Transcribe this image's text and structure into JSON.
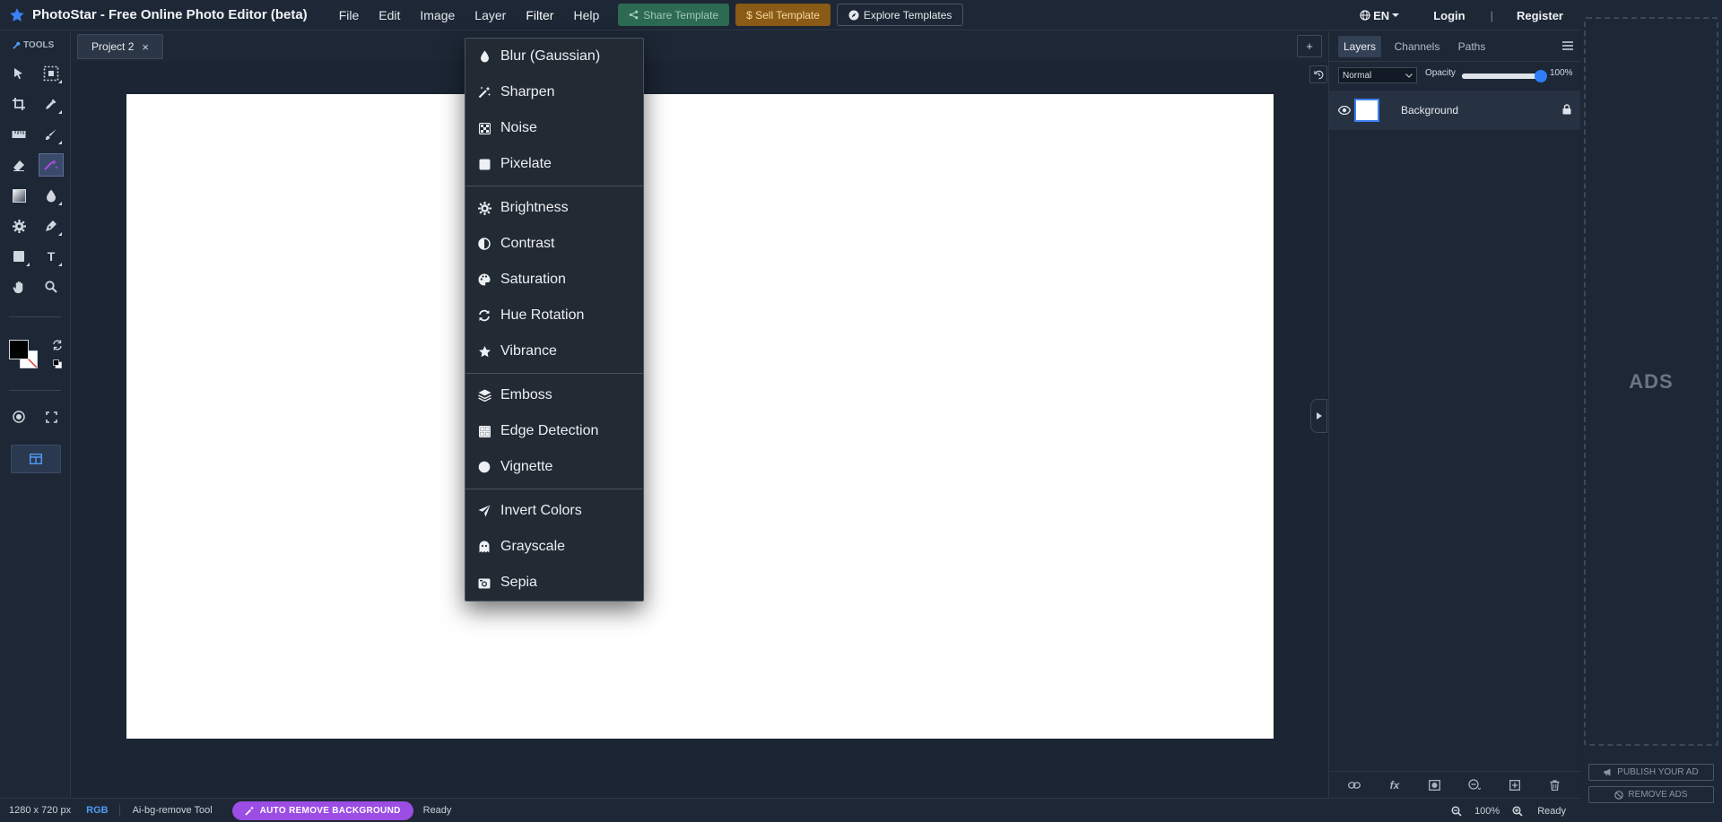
{
  "app": {
    "title": "PhotoStar - Free Online Photo Editor (beta)",
    "menus": [
      "File",
      "Edit",
      "Image",
      "Layer",
      "Filter",
      "Help"
    ],
    "share_template": "Share Template",
    "sell_template": "$ Sell Template",
    "explore_templates": "Explore Templates",
    "language": "EN",
    "login": "Login",
    "separator": "|",
    "register": "Register"
  },
  "toolbar": {
    "label": "TOOLS",
    "tools": [
      {
        "name": "move-tool-icon"
      },
      {
        "name": "marquee-select-tool-icon"
      },
      {
        "name": "crop-tool-icon"
      },
      {
        "name": "eyedropper-tool-icon"
      },
      {
        "name": "ruler-tool-icon"
      },
      {
        "name": "brush-tool-icon"
      },
      {
        "name": "eraser-tool-icon"
      },
      {
        "name": "magic-wand-tool-icon"
      },
      {
        "name": "gradient-tool-icon"
      },
      {
        "name": "blur-drop-tool-icon"
      },
      {
        "name": "settings-tool-icon"
      },
      {
        "name": "pen-tool-icon"
      },
      {
        "name": "shape-tool-icon"
      },
      {
        "name": "text-tool-icon"
      },
      {
        "name": "hand-tool-icon"
      },
      {
        "name": "zoom-tool-icon"
      }
    ],
    "text_tool_glyph": "T",
    "colors": {
      "foreground": "#000000",
      "background": "#ffffff"
    }
  },
  "document": {
    "tab_label": "Project 2",
    "tab_close": "×",
    "add_tab": "+"
  },
  "filter_menu": {
    "groups": [
      [
        {
          "label": "Blur (Gaussian)",
          "icon": "droplet-icon"
        },
        {
          "label": "Sharpen",
          "icon": "magic-wand-icon"
        },
        {
          "label": "Noise",
          "icon": "checkerboard-icon"
        },
        {
          "label": "Pixelate",
          "icon": "square-icon"
        }
      ],
      [
        {
          "label": "Brightness",
          "icon": "sun-icon"
        },
        {
          "label": "Contrast",
          "icon": "half-circle-icon"
        },
        {
          "label": "Saturation",
          "icon": "palette-icon"
        },
        {
          "label": "Hue Rotation",
          "icon": "sync-icon"
        },
        {
          "label": "Vibrance",
          "icon": "star-icon"
        }
      ],
      [
        {
          "label": "Emboss",
          "icon": "layers-icon"
        },
        {
          "label": "Edge Detection",
          "icon": "grid-icon"
        },
        {
          "label": "Vignette",
          "icon": "circle-icon"
        }
      ],
      [
        {
          "label": "Invert Colors",
          "icon": "paper-plane-icon"
        },
        {
          "label": "Grayscale",
          "icon": "ghost-icon"
        },
        {
          "label": "Sepia",
          "icon": "camera-retro-icon"
        }
      ]
    ]
  },
  "layers_panel": {
    "tabs": [
      "Layers",
      "Channels",
      "Paths"
    ],
    "active_tab": "Layers",
    "blend_mode": "Normal",
    "opacity_label": "Opacity",
    "opacity_value": "100%",
    "opacity_fraction": 1.0,
    "layers": [
      {
        "name": "Background",
        "visible": true,
        "locked": true
      }
    ],
    "bottom_fx": "fx"
  },
  "ads": {
    "label": "ADS",
    "publish": "PUBLISH YOUR AD",
    "remove": "REMOVE ADS"
  },
  "status": {
    "size": "1280 x 720 px",
    "mode": "RGB",
    "tool": "Ai-bg-remove Tool",
    "auto_remove": "AUTO REMOVE BACKGROUND",
    "ready": "Ready",
    "zoom": "100%",
    "ready_right": "Ready"
  }
}
